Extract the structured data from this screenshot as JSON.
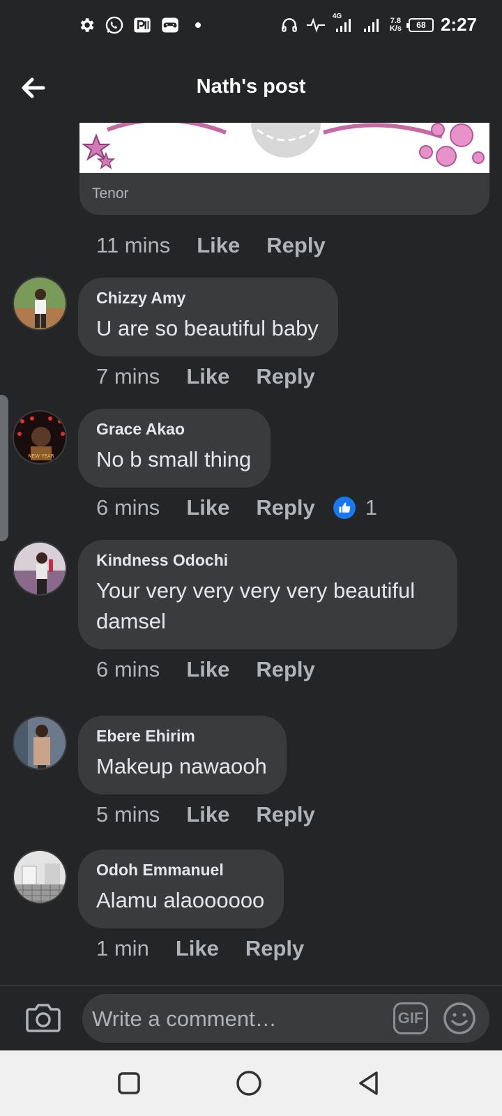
{
  "status_bar": {
    "left_icons": [
      "gear-icon",
      "whatsapp-icon",
      "parking-app-icon",
      "game-controller-icon",
      "dot-icon"
    ],
    "right_icons": [
      "headphones-icon",
      "activity-icon",
      "signal-4g-icon",
      "signal-icon"
    ],
    "network_type": "4G",
    "speed_value": "7.8",
    "speed_unit": "K/s",
    "battery": "68",
    "time": "2:27"
  },
  "header": {
    "title": "Nath's post"
  },
  "gif_card": {
    "source": "Tenor"
  },
  "first_meta": {
    "time": "11 mins",
    "like": "Like",
    "reply": "Reply"
  },
  "comments": [
    {
      "author": "Chizzy Amy",
      "text": "U are so beautiful baby",
      "time": "7 mins",
      "like": "Like",
      "reply": "Reply"
    },
    {
      "author": "Grace Akao",
      "text": "No b small thing",
      "time": "6 mins",
      "like": "Like",
      "reply": "Reply",
      "reactions": "1"
    },
    {
      "author": "Kindness Odochi",
      "text": "Your very very very very beautiful damsel",
      "time": "6 mins",
      "like": "Like",
      "reply": "Reply"
    },
    {
      "author": "Ebere Ehirim",
      "text": "Makeup nawaooh",
      "time": "5 mins",
      "like": "Like",
      "reply": "Reply"
    },
    {
      "author": "Odoh Emmanuel",
      "text": "Alamu alaoooooo",
      "time": "1 min",
      "like": "Like",
      "reply": "Reply"
    }
  ],
  "composer": {
    "placeholder": "Write a comment…",
    "gif_label": "GIF"
  },
  "colors": {
    "background": "#242526",
    "bubble": "#3a3b3c",
    "text": "#e4e6eb",
    "secondary_text": "#b0b3b8",
    "accent": "#1877f2",
    "nav_bar": "#f0f0f0"
  }
}
